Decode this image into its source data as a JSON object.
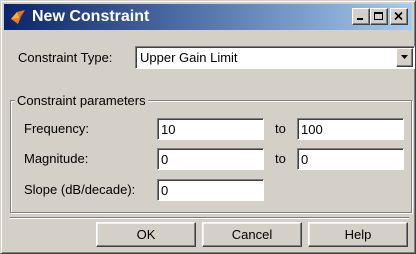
{
  "window": {
    "title": "New Constraint",
    "controls": {
      "minimize": "minimize-icon",
      "maximize": "maximize-icon",
      "close": "close-icon"
    },
    "titlebar_gradient": [
      "#0a246a",
      "#a6caf0"
    ],
    "face_color": "#d4d0c8"
  },
  "constraint_type": {
    "label": "Constraint Type:",
    "selected": "Upper Gain Limit"
  },
  "parameters": {
    "group_title": "Constraint parameters",
    "to_label": "to",
    "frequency": {
      "label": "Frequency:",
      "from": "10",
      "to": "100"
    },
    "magnitude": {
      "label": "Magnitude:",
      "from": "0",
      "to": "0"
    },
    "slope": {
      "label": "Slope (dB/decade):",
      "value": "0"
    }
  },
  "buttons": {
    "ok": "OK",
    "cancel": "Cancel",
    "help": "Help"
  }
}
